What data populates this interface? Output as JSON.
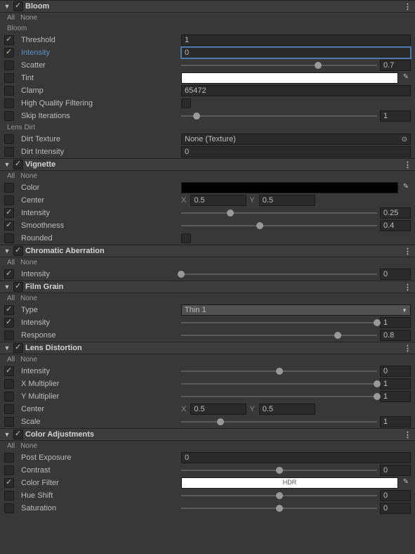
{
  "effects": [
    {
      "id": "bloom",
      "title": "Bloom",
      "checked": true,
      "sublabels": [
        "Bloom",
        "Lens Dirt"
      ],
      "rows": [
        {
          "id": "threshold",
          "label": "Threshold",
          "checked": true,
          "type": "num",
          "value": "1"
        },
        {
          "id": "intensity",
          "label": "Intensity",
          "checked": true,
          "type": "num",
          "value": "0",
          "highlight": true,
          "focused": true
        },
        {
          "id": "scatter",
          "label": "Scatter",
          "checked": false,
          "type": "slider",
          "value": "0.7",
          "pos": 70
        },
        {
          "id": "tint",
          "label": "Tint",
          "checked": false,
          "type": "color",
          "color": "white",
          "eyedrop": true
        },
        {
          "id": "clamp",
          "label": "Clamp",
          "checked": false,
          "type": "num",
          "value": "65472"
        },
        {
          "id": "hqf",
          "label": "High Quality Filtering",
          "checked": false,
          "type": "check",
          "value": false
        },
        {
          "id": "skip",
          "label": "Skip Iterations",
          "checked": false,
          "type": "slider",
          "value": "1",
          "pos": 8
        },
        {
          "id": "dirttex",
          "label": "Dirt Texture",
          "checked": false,
          "type": "obj",
          "value": "None (Texture)"
        },
        {
          "id": "dirtint",
          "label": "Dirt Intensity",
          "checked": false,
          "type": "num",
          "value": "0"
        }
      ]
    },
    {
      "id": "vignette",
      "title": "Vignette",
      "checked": true,
      "rows": [
        {
          "id": "color",
          "label": "Color",
          "checked": false,
          "type": "color",
          "color": "black",
          "eyedrop": true
        },
        {
          "id": "center",
          "label": "Center",
          "checked": false,
          "type": "xy",
          "x": "0.5",
          "y": "0.5"
        },
        {
          "id": "intensity",
          "label": "Intensity",
          "checked": true,
          "type": "slider",
          "value": "0.25",
          "pos": 25
        },
        {
          "id": "smoothness",
          "label": "Smoothness",
          "checked": true,
          "type": "slider",
          "value": "0.4",
          "pos": 40
        },
        {
          "id": "rounded",
          "label": "Rounded",
          "checked": false,
          "type": "check",
          "value": false
        }
      ]
    },
    {
      "id": "chromab",
      "title": "Chromatic Aberration",
      "checked": true,
      "rows": [
        {
          "id": "intensity",
          "label": "Intensity",
          "checked": true,
          "type": "slider",
          "value": "0",
          "pos": 0
        }
      ]
    },
    {
      "id": "filmgrain",
      "title": "Film Grain",
      "checked": true,
      "rows": [
        {
          "id": "type",
          "label": "Type",
          "checked": true,
          "type": "dropdown",
          "value": "Thin 1"
        },
        {
          "id": "intensity",
          "label": "Intensity",
          "checked": true,
          "type": "slider",
          "value": "1",
          "pos": 100
        },
        {
          "id": "response",
          "label": "Response",
          "checked": false,
          "type": "slider",
          "value": "0.8",
          "pos": 80
        }
      ]
    },
    {
      "id": "lensdist",
      "title": "Lens Distortion",
      "checked": true,
      "rows": [
        {
          "id": "intensity",
          "label": "Intensity",
          "checked": true,
          "type": "slider",
          "value": "0",
          "pos": 50
        },
        {
          "id": "xmult",
          "label": "X Multiplier",
          "checked": false,
          "type": "slider",
          "value": "1",
          "pos": 100
        },
        {
          "id": "ymult",
          "label": "Y Multiplier",
          "checked": false,
          "type": "slider",
          "value": "1",
          "pos": 100
        },
        {
          "id": "center",
          "label": "Center",
          "checked": false,
          "type": "xy",
          "x": "0.5",
          "y": "0.5"
        },
        {
          "id": "scale",
          "label": "Scale",
          "checked": false,
          "type": "slider",
          "value": "1",
          "pos": 20
        }
      ]
    },
    {
      "id": "coloradj",
      "title": "Color Adjustments",
      "checked": true,
      "rows": [
        {
          "id": "postexp",
          "label": "Post Exposure",
          "checked": false,
          "type": "num",
          "value": "0"
        },
        {
          "id": "contrast",
          "label": "Contrast",
          "checked": false,
          "type": "slider",
          "value": "0",
          "pos": 50
        },
        {
          "id": "colorfilter",
          "label": "Color Filter",
          "checked": true,
          "type": "color",
          "color": "white",
          "eyedrop": true,
          "hdr": "HDR"
        },
        {
          "id": "hueshift",
          "label": "Hue Shift",
          "checked": false,
          "type": "slider",
          "value": "0",
          "pos": 50
        },
        {
          "id": "saturation",
          "label": "Saturation",
          "checked": false,
          "type": "slider",
          "value": "0",
          "pos": 50
        }
      ]
    }
  ],
  "allnone": {
    "all": "All",
    "none": "None"
  }
}
